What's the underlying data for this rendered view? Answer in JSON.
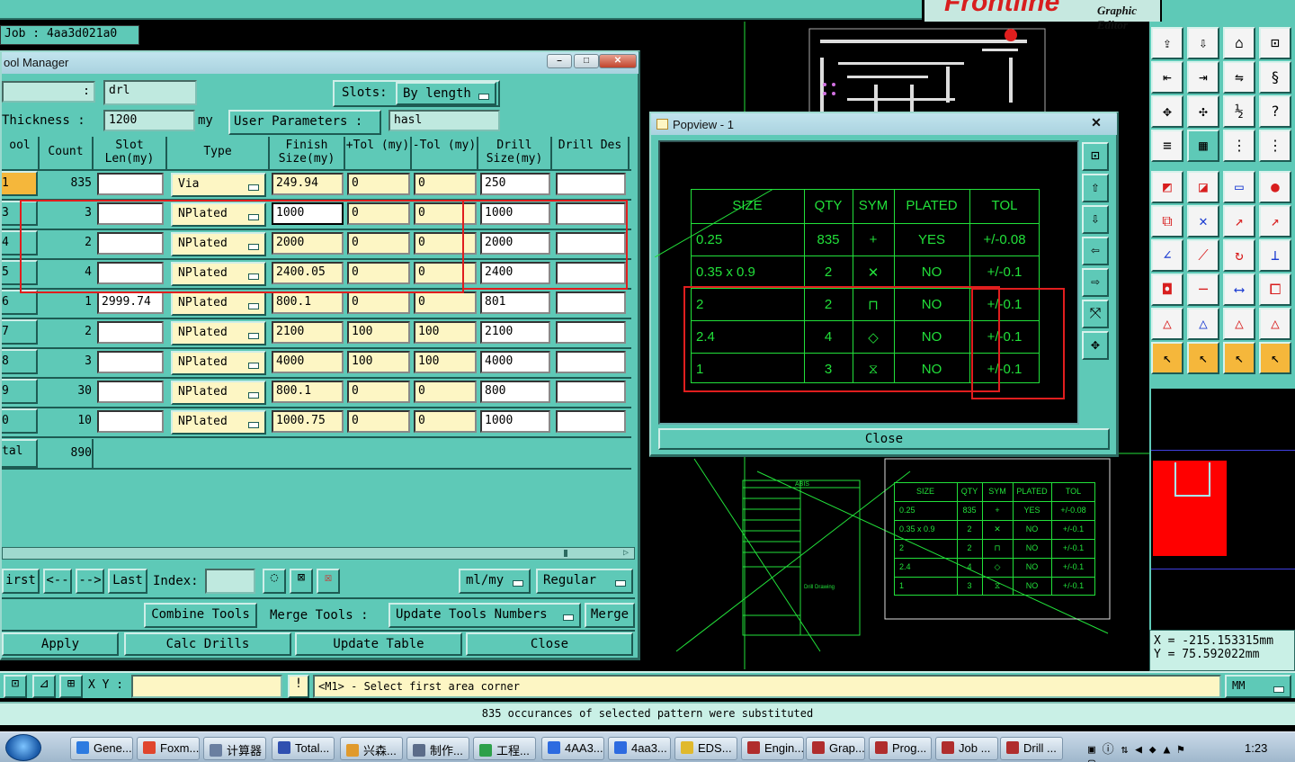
{
  "app": {
    "brand": "Frontline",
    "subtitle": "Graphic Editor",
    "job": "Job : 4aa3d021a0"
  },
  "tool_manager": {
    "title": "ool Manager",
    "drill_layer": "drl",
    "slots_label": "Slots:",
    "slots_value": "By length",
    "thickness_label": "Thickness :",
    "thickness_value": "1200",
    "thickness_unit": "my",
    "user_params_label": "User Parameters :",
    "user_params_value": "hasl",
    "columns": [
      "ool",
      "Count",
      "Slot Len(my)",
      "Type",
      "Finish Size(my)",
      "+Tol (my)",
      "-Tol (my)",
      "Drill Size(my)",
      "Drill Des"
    ],
    "rows": [
      {
        "tool": "1",
        "count": "835",
        "slot": "",
        "type": "Via",
        "finish": "249.94",
        "ptol": "0",
        "ntol": "0",
        "drill": "250",
        "des": ""
      },
      {
        "tool": "3",
        "count": "3",
        "slot": "",
        "type": "NPlated",
        "finish": "1000",
        "ptol": "0",
        "ntol": "0",
        "drill": "1000",
        "des": ""
      },
      {
        "tool": "4",
        "count": "2",
        "slot": "",
        "type": "NPlated",
        "finish": "2000",
        "ptol": "0",
        "ntol": "0",
        "drill": "2000",
        "des": ""
      },
      {
        "tool": "5",
        "count": "4",
        "slot": "",
        "type": "NPlated",
        "finish": "2400.05",
        "ptol": "0",
        "ntol": "0",
        "drill": "2400",
        "des": ""
      },
      {
        "tool": "6",
        "count": "1",
        "slot": "2999.74",
        "type": "NPlated",
        "finish": "800.1",
        "ptol": "0",
        "ntol": "0",
        "drill": "801",
        "des": ""
      },
      {
        "tool": "7",
        "count": "2",
        "slot": "",
        "type": "NPlated",
        "finish": "2100",
        "ptol": "100",
        "ntol": "100",
        "drill": "2100",
        "des": ""
      },
      {
        "tool": "8",
        "count": "3",
        "slot": "",
        "type": "NPlated",
        "finish": "4000",
        "ptol": "100",
        "ntol": "100",
        "drill": "4000",
        "des": ""
      },
      {
        "tool": "9",
        "count": "30",
        "slot": "",
        "type": "NPlated",
        "finish": "800.1",
        "ptol": "0",
        "ntol": "0",
        "drill": "800",
        "des": ""
      },
      {
        "tool": "0",
        "count": "10",
        "slot": "",
        "type": "NPlated",
        "finish": "1000.75",
        "ptol": "0",
        "ntol": "0",
        "drill": "1000",
        "des": ""
      }
    ],
    "total_label": "tal",
    "total_count": "890",
    "nav": {
      "first": "irst",
      "prev": "<--",
      "next": "-->",
      "last": "Last",
      "index_label": "Index:",
      "units": "ml/my",
      "mode": "Regular"
    },
    "actions": {
      "combine": "Combine Tools",
      "merge_label": "Merge Tools :",
      "update_numbers": "Update Tools Numbers",
      "merge": "Merge"
    },
    "bottom": {
      "apply": "Apply",
      "calc": "Calc Drills",
      "update_table": "Update Table",
      "close": "Close"
    }
  },
  "popview": {
    "title": "Popview - 1",
    "close": "Close",
    "headers": [
      "SIZE",
      "QTY",
      "SYM",
      "PLATED",
      "TOL"
    ],
    "rows": [
      {
        "size": "0.25",
        "qty": "835",
        "plated": "YES",
        "tol": "+/-0.08"
      },
      {
        "size": "0.35 x 0.9",
        "qty": "2",
        "plated": "NO",
        "tol": "+/-0.1"
      },
      {
        "size": "2",
        "qty": "2",
        "plated": "NO",
        "tol": "+/-0.1"
      },
      {
        "size": "2.4",
        "qty": "4",
        "plated": "NO",
        "tol": "+/-0.1"
      },
      {
        "size": "1",
        "qty": "3",
        "plated": "NO",
        "tol": "+/-0.1"
      }
    ]
  },
  "canvas_table": {
    "headers": [
      "SIZE",
      "QTY",
      "SYM",
      "PLATED",
      "TOL"
    ],
    "rows": [
      {
        "size": "0.25",
        "qty": "835",
        "plated": "YES",
        "tol": "+/-0.08"
      },
      {
        "size": "0.35 x 0.9",
        "qty": "2",
        "plated": "NO",
        "tol": "+/-0.1"
      },
      {
        "size": "2",
        "qty": "2",
        "plated": "NO",
        "tol": "+/-0.1"
      },
      {
        "size": "2.4",
        "qty": "4",
        "plated": "NO",
        "tol": "+/-0.1"
      },
      {
        "size": "1",
        "qty": "3",
        "plated": "NO",
        "tol": "+/-0.1"
      }
    ],
    "drill_drawing": "Drill Drawing",
    "title_block": "ABIS"
  },
  "coords": {
    "x": "X = -215.153315mm",
    "y": "Y = 75.592022mm"
  },
  "command": {
    "xy_label": "X Y :",
    "prompt": "<M1> - Select first area corner",
    "units": "MM"
  },
  "status": "835 occurances of selected pattern were substituted",
  "taskbar": {
    "items": [
      "Gene...",
      "Foxm...",
      "计算器",
      "Total...",
      "兴森...",
      "制作...",
      "工程...",
      "4AA3...",
      "4aa3...",
      "EDS...",
      "Engin...",
      "Grap...",
      "Prog...",
      "Job ...",
      "Drill ..."
    ],
    "clock": "1:23"
  }
}
